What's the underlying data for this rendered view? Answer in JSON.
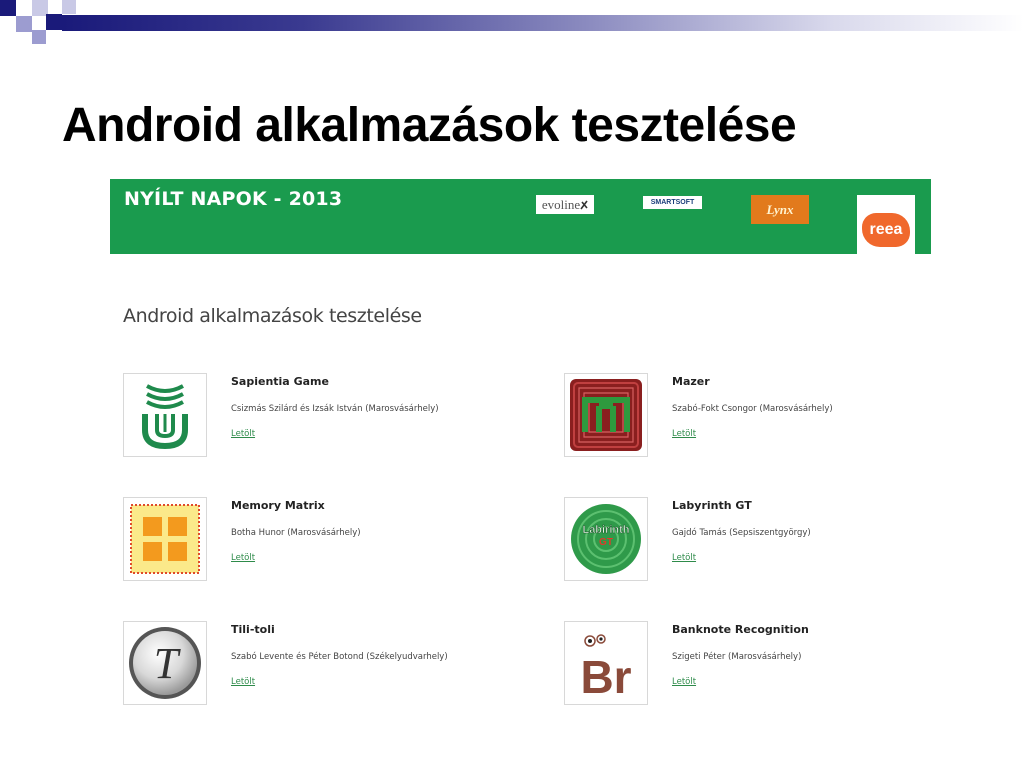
{
  "slide": {
    "title": "Android alkalmazások tesztelése"
  },
  "banner": {
    "title": "NYÍLT NAPOK - 2013",
    "sponsors": [
      {
        "name": "evoline-logo",
        "text": "evoline"
      },
      {
        "name": "smartsoft-logo",
        "text": "SMARTSOFT"
      },
      {
        "name": "lynx-logo",
        "text": "Lynx"
      },
      {
        "name": "reea-logo",
        "text": "reea"
      }
    ]
  },
  "page": {
    "heading": "Android alkalmazások tesztelése"
  },
  "apps": [
    {
      "name": "Sapientia Game",
      "author": "Csizmás Szilárd és Izsák István (Marosvásárhely)",
      "link": "Letölt",
      "icon": "sapientia-logo-icon"
    },
    {
      "name": "Mazer",
      "author": "Szabó-Fokt Csongor (Marosvásárhely)",
      "link": "Letölt",
      "icon": "maze-icon"
    },
    {
      "name": "Memory Matrix",
      "author": "Botha Hunor (Marosvásárhely)",
      "link": "Letölt",
      "icon": "memory-grid-icon"
    },
    {
      "name": "Labyrinth GT",
      "author": "Gajdó Tamás (Sepsiszentgyörgy)",
      "link": "Letölt",
      "icon": "labyrinth-disc-icon",
      "icon_text_1": "Labirinth",
      "icon_text_2": "GT"
    },
    {
      "name": "Tili-toli",
      "author": "Szabó Levente és Péter Botond (Székelyudvarhely)",
      "link": "Letölt",
      "icon": "letter-t-icon",
      "icon_text": "T"
    },
    {
      "name": "Banknote Recognition",
      "author": "Szigeti Péter (Marosvásárhely)",
      "link": "Letölt",
      "icon": "br-monster-icon",
      "icon_text": "Br"
    }
  ],
  "colors": {
    "banner_green": "#1a9b4e",
    "link_green": "#2e8b4a",
    "deco_navy": "#1a1a7a",
    "deco_lavender": "#9c9cd0"
  }
}
